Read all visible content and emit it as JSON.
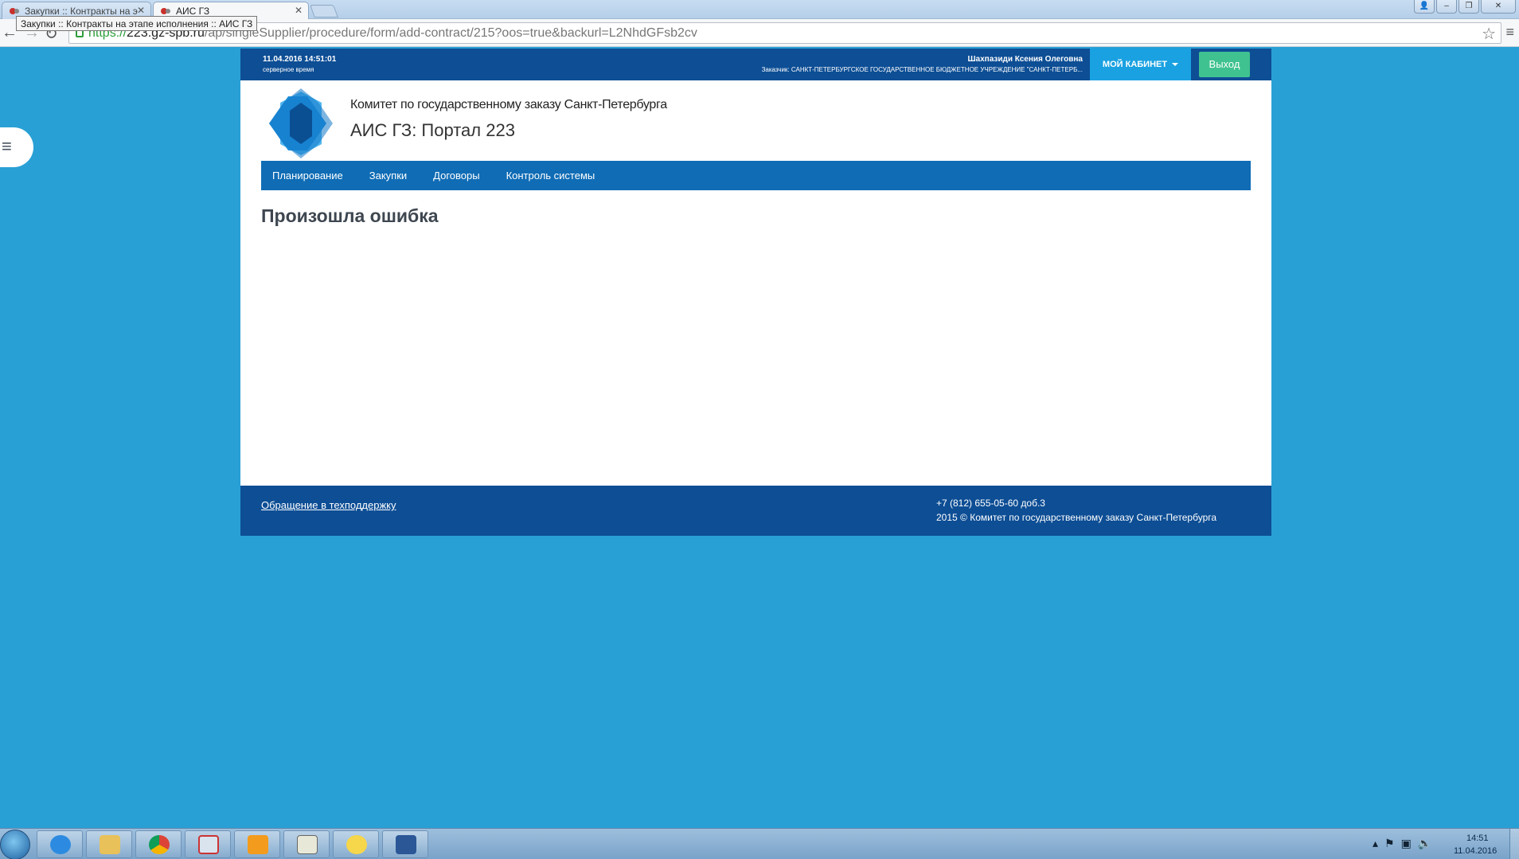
{
  "browser": {
    "tabs": [
      {
        "label": "Закупки :: Контракты на э"
      },
      {
        "label": "АИС ГЗ"
      }
    ],
    "tooltip": "Закупки :: Контракты на этапе исполнения :: АИС ГЗ",
    "url": {
      "scheme": "https://",
      "host": "223.gz-spb.ru",
      "path": "/ap/singleSupplier/procedure/form/add-contract/215?oos=true&backurl=L2NhdGFsb2cv"
    }
  },
  "header": {
    "server_time": "11.04.2016 14:51:01",
    "server_time_label": "серверное время",
    "user_name": "Шахпазиди Ксения Олеговна",
    "customer": "Заказчик: САНКТ-ПЕТЕРБУРГСКОЕ ГОСУДАРСТВЕННОЕ БЮДЖЕТНОЕ УЧРЕЖДЕНИЕ \"САНКТ-ПЕТЕРБ...",
    "cabinet_label": "МОЙ КАБИНЕТ",
    "logout_label": "Выход"
  },
  "brand": {
    "org_name": "Комитет по государственному заказу Санкт-Петербурга",
    "portal_name": "АИС ГЗ: Портал 223"
  },
  "nav": {
    "items": [
      {
        "label": "Планирование"
      },
      {
        "label": "Закупки"
      },
      {
        "label": "Договоры"
      },
      {
        "label": "Контроль системы"
      }
    ]
  },
  "main": {
    "error_title": "Произошла ошибка"
  },
  "footer": {
    "support_link": "Обращение в техподдержку",
    "phone": "+7 (812) 655-05-60 доб.3",
    "copyright": "2015 © Комитет по государственному заказу Санкт-Петербурга"
  },
  "taskbar": {
    "clock_time": "14:51",
    "clock_date": "11.04.2016"
  },
  "colors": {
    "page_bg": "#29a0d5",
    "topbar": "#0d4e95",
    "nav": "#0f6cb5",
    "cabinet": "#1aa1e1",
    "logout": "#3fc28f"
  }
}
